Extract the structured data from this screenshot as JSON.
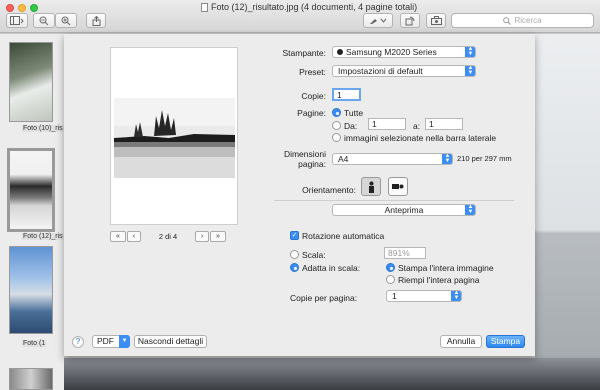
{
  "window": {
    "title": "Foto (12)_risultato.jpg (4 documenti, 4 pagine totali)",
    "search_placeholder": "Ricerca"
  },
  "sidebar": {
    "items": [
      {
        "label": "Foto (10)_ris"
      },
      {
        "label": "Foto (12)_ris"
      },
      {
        "label": "Foto (1"
      }
    ]
  },
  "preview": {
    "page_indicator": "2 di 4",
    "first": "«",
    "prev": "‹",
    "next": "›",
    "last": "»"
  },
  "print": {
    "printer_label": "Stampante:",
    "printer_value": "Samsung M2020 Series",
    "preset_label": "Preset:",
    "preset_value": "Impostazioni di default",
    "copies_label": "Copie:",
    "copies_value": "1",
    "pages_label": "Pagine:",
    "pages_all": "Tutte",
    "pages_from_label": "Da:",
    "pages_from_value": "1",
    "pages_to_label": "a:",
    "pages_to_value": "1",
    "pages_selected": "immagini selezionate nella barra laterale",
    "paper_label": "Dimensioni pagina:",
    "paper_value": "A4",
    "paper_dims": "210 per 297 mm",
    "orientation_label": "Orientamento:",
    "section_value": "Anteprima",
    "auto_rotate_label": "Rotazione automatica",
    "scale_label": "Scala:",
    "scale_value": "891%",
    "fit_label": "Adatta in scala:",
    "fit_print_entire": "Stampa l'intera immagine",
    "fit_fill_page": "Riempi l'intera pagina",
    "copies_per_page_label": "Copie per pagina:",
    "copies_per_page_value": "1"
  },
  "footer": {
    "help": "?",
    "pdf": "PDF",
    "hide_details": "Nascondi dettagli",
    "cancel": "Annulla",
    "print": "Stampa"
  },
  "colors": {
    "accent": "#3b8ef5"
  }
}
